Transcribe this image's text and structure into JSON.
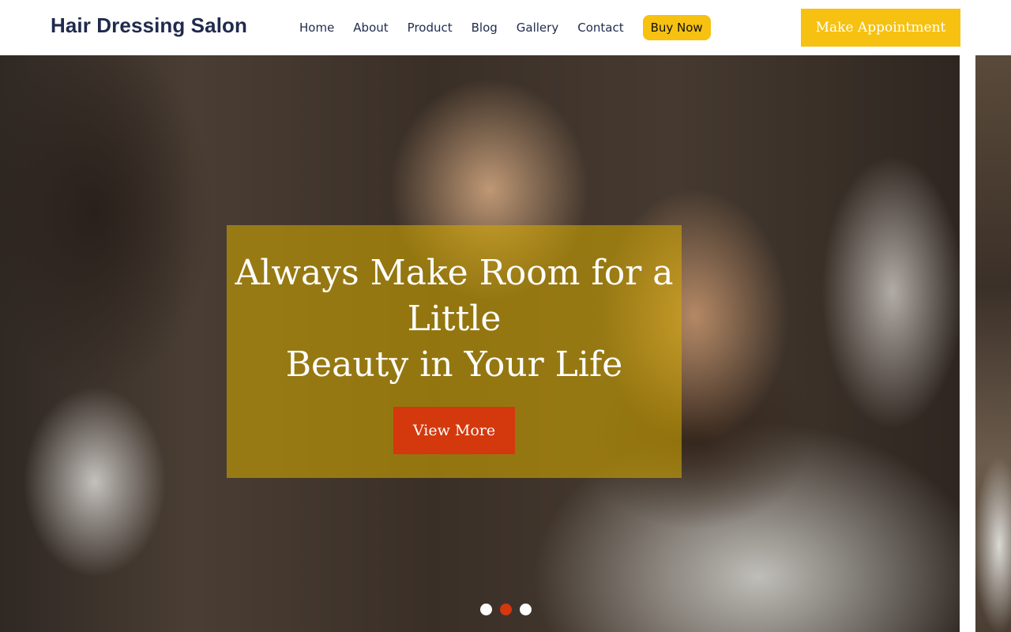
{
  "header": {
    "brand": "Hair Dressing Salon",
    "nav": [
      "Home",
      "About",
      "Product",
      "Blog",
      "Gallery",
      "Contact"
    ],
    "buy_now": "Buy Now",
    "appointment": "Make Appointment"
  },
  "hero": {
    "title_lines": [
      "Always Make Room for a",
      "Little",
      "Beauty in Your Life"
    ],
    "cta": "View More",
    "slide_count": 3,
    "active_slide": 2
  },
  "colors": {
    "brand_text": "#1f2a4d",
    "accent_yellow": "#f6c111",
    "accent_red": "#d4380d"
  }
}
